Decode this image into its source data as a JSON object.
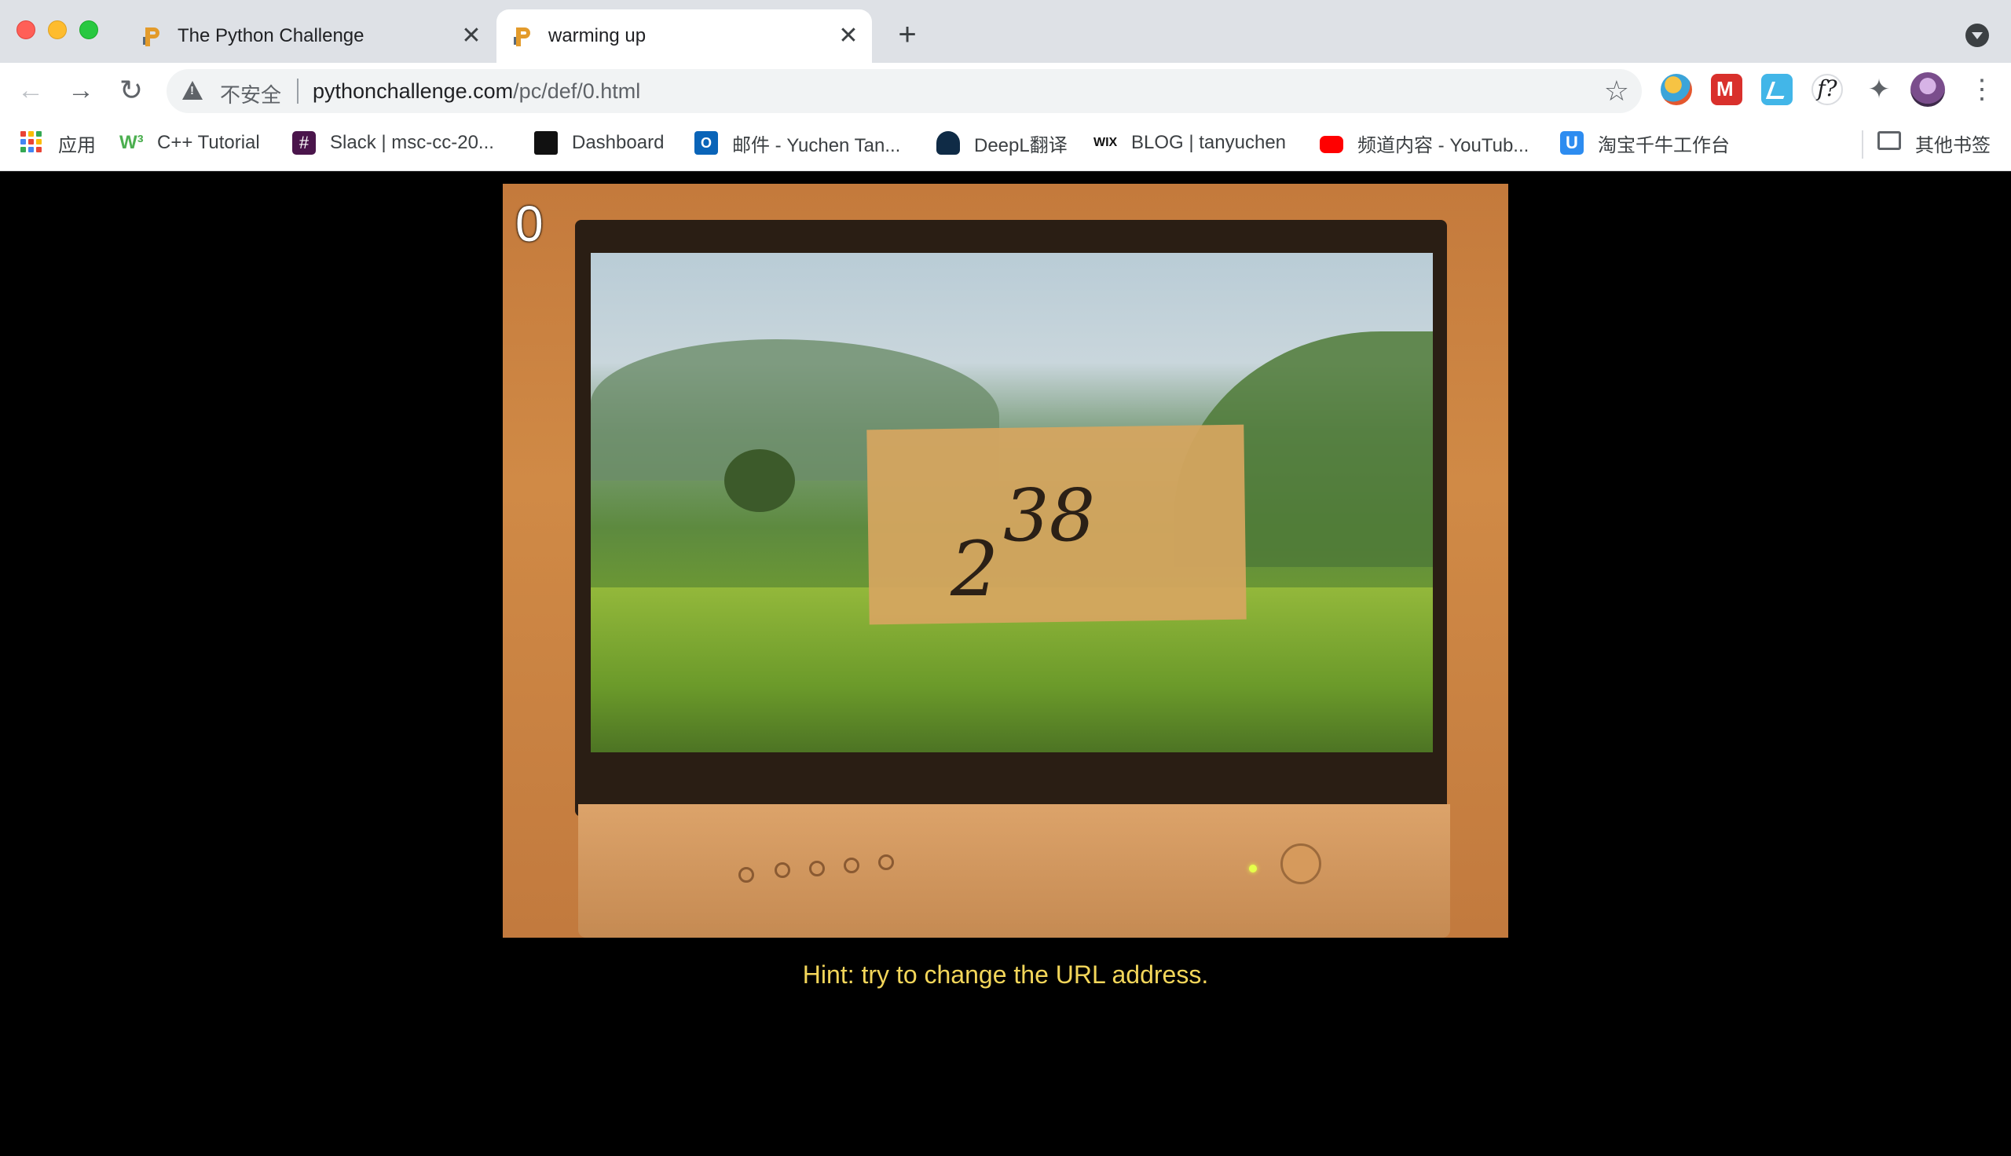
{
  "tabs": [
    {
      "title": "The Python Challenge",
      "active": false,
      "icon": "python-challenge-favicon"
    },
    {
      "title": "warming up",
      "active": true,
      "icon": "python-challenge-favicon"
    }
  ],
  "toolbar": {
    "security_label": "不安全",
    "url_host": "pythonchallenge.com",
    "url_path": "/pc/def/0.html"
  },
  "bookmarks": [
    {
      "label": "应用",
      "icon": "apps-grid-icon"
    },
    {
      "label": "C++ Tutorial",
      "icon": "w3schools-icon"
    },
    {
      "label": "Slack | msc-cc-20...",
      "icon": "slack-icon"
    },
    {
      "label": "Dashboard",
      "icon": "dashboard-icon"
    },
    {
      "label": "邮件 - Yuchen Tan...",
      "icon": "outlook-icon"
    },
    {
      "label": "DeepL翻译",
      "icon": "deepl-icon"
    },
    {
      "label": "BLOG | tanyuchen",
      "icon": "wix-icon"
    },
    {
      "label": "频道内容 - YouTub...",
      "icon": "youtube-icon"
    },
    {
      "label": "淘宝千牛工作台",
      "icon": "qianniu-icon"
    }
  ],
  "other_bookmarks": "其他书签",
  "page": {
    "level_number": "0",
    "base": "2",
    "exponent": "38",
    "hint": "Hint: try to change the URL address."
  },
  "colors": {
    "hint_text": "#f3d65a",
    "page_background": "#000000",
    "tabstrip": "#dee1e6"
  }
}
